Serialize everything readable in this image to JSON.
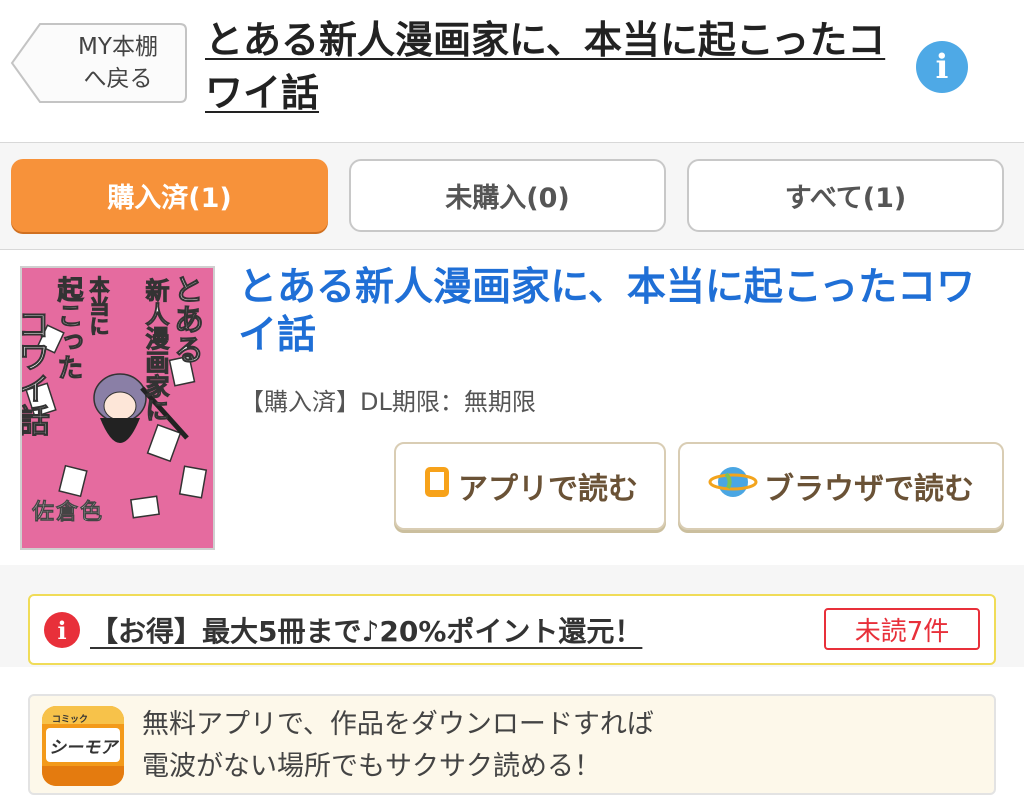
{
  "header": {
    "back_line1": "MY本棚",
    "back_line2": "へ戻る",
    "title": "とある新人漫画家に、本当に起こったコワイ話",
    "info_icon": "info-icon"
  },
  "tabs": [
    {
      "label": "購入済(1)",
      "active": true
    },
    {
      "label": "未購入(0)",
      "active": false
    },
    {
      "label": "すべて(1)",
      "active": false
    }
  ],
  "book": {
    "title": "とある新人漫画家に、本当に起こったコワイ話",
    "status": "【購入済】DL期限：無期限",
    "cover": {
      "title_col1": "とある",
      "title_col2": "新人漫画家に",
      "title_col3": "本当に",
      "title_col4": "起こった",
      "title_col5": "コワイ話",
      "author": "佐倉色"
    },
    "app_read_label": "アプリで読む",
    "browser_read_label": "ブラウザで読む"
  },
  "promo": {
    "text": "【お得】最大5冊まで♪20%ポイント還元！",
    "unread_badge": "未読7件"
  },
  "app_banner": {
    "icon_small": "コミック",
    "icon_name": "シーモア",
    "line1": "無料アプリで、作品をダウンロードすれば",
    "line2": "電波がない場所でもサクサク読める！"
  },
  "colors": {
    "accent_orange": "#f7923a",
    "title_blue": "#1f6fd6",
    "alert_red": "#e8303a",
    "info_blue": "#4ea9e6"
  }
}
